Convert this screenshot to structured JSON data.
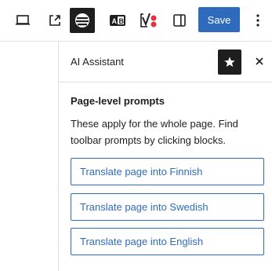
{
  "toolbar": {
    "save_label": "Save",
    "icons": [
      "desktop-preview-icon",
      "external-preview-icon",
      "ai-assistant-icon",
      "translate-ab-icon",
      "yoast-icon",
      "sidebar-toggle-icon",
      "more-options-icon"
    ]
  },
  "panel": {
    "title": "AI Assistant",
    "section_title": "Page-level prompts",
    "description": "These apply for the whole page. Find toolbar prompts by clicking blocks.",
    "prompts": [
      "Translate page into Finnish",
      "Translate page into Swedish",
      "Translate page into English"
    ]
  },
  "colors": {
    "accent": "#2f6bbd",
    "dark": "#1e1e1e",
    "yoast_dot": "#e2343f"
  }
}
